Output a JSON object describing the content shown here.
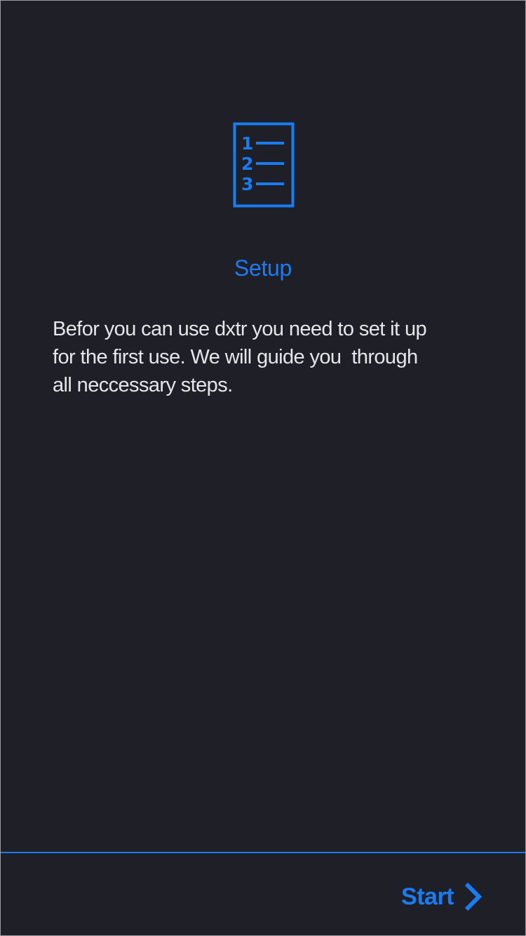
{
  "setup": {
    "icon": "numbered-list-icon",
    "icon_numbers": [
      "1",
      "2",
      "3"
    ],
    "title": "Setup",
    "description": "Befor you can use dxtr you need to set it up\nfor the first use. We will guide you  through\nall neccessary steps."
  },
  "footer": {
    "start_label": "Start",
    "start_icon": "chevron-right-icon"
  },
  "colors": {
    "background": "#1f1f28",
    "accent": "#1a7cf2",
    "text": "#e6e6ea"
  }
}
